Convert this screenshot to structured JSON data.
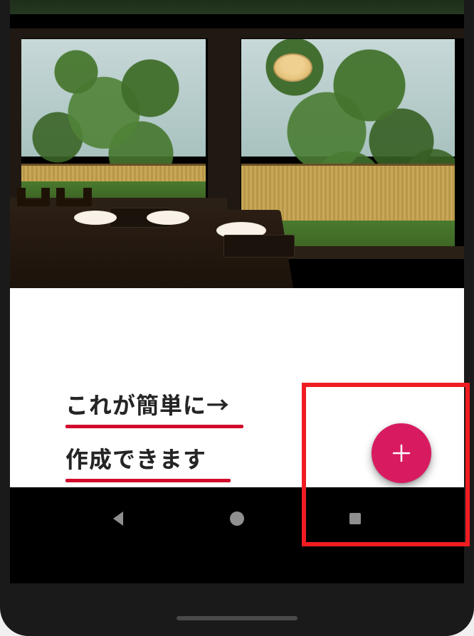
{
  "annotation": {
    "line1": "これが簡単に→",
    "line2": "作成できます"
  },
  "fab": {
    "icon": "plus-icon"
  },
  "colors": {
    "accent": "#d81b60",
    "underline": "#d20a2c",
    "highlight": "#f01c22"
  }
}
